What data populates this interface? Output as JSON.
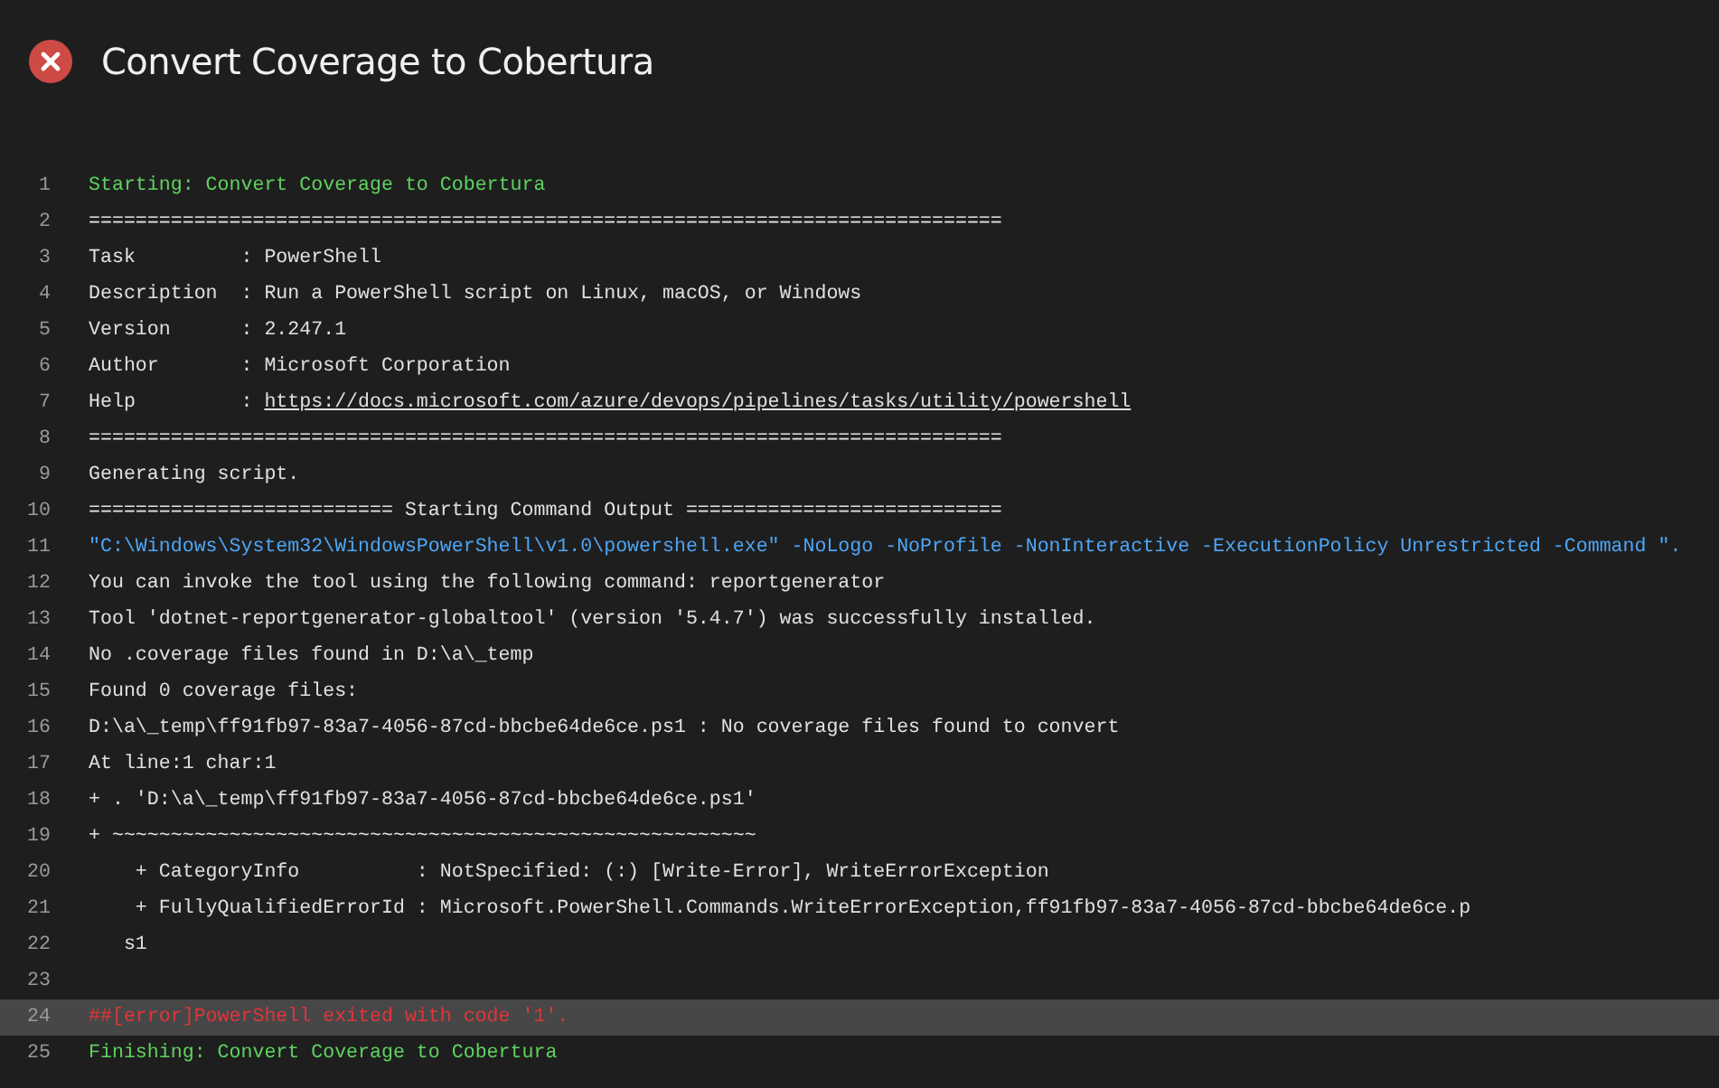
{
  "header": {
    "failed": true,
    "title": "Convert Coverage to Cobertura"
  },
  "log": [
    {
      "number": "1",
      "kind": "section",
      "text": "Starting: Convert Coverage to Cobertura"
    },
    {
      "number": "2",
      "kind": "plain",
      "text": "=============================================================================="
    },
    {
      "number": "3",
      "kind": "plain",
      "text": "Task         : PowerShell"
    },
    {
      "number": "4",
      "kind": "plain",
      "text": "Description  : Run a PowerShell script on Linux, macOS, or Windows"
    },
    {
      "number": "5",
      "kind": "plain",
      "text": "Version      : 2.247.1"
    },
    {
      "number": "6",
      "kind": "plain",
      "text": "Author       : Microsoft Corporation"
    },
    {
      "number": "7",
      "kind": "link",
      "text": "Help         : ",
      "link": "https://docs.microsoft.com/azure/devops/pipelines/tasks/utility/powershell"
    },
    {
      "number": "8",
      "kind": "plain",
      "text": "=============================================================================="
    },
    {
      "number": "9",
      "kind": "plain",
      "text": "Generating script."
    },
    {
      "number": "10",
      "kind": "plain",
      "text": "========================== Starting Command Output ==========================="
    },
    {
      "number": "11",
      "kind": "command",
      "text": "\"C:\\Windows\\System32\\WindowsPowerShell\\v1.0\\powershell.exe\" -NoLogo -NoProfile -NonInteractive -ExecutionPolicy Unrestricted -Command \"."
    },
    {
      "number": "12",
      "kind": "plain",
      "text": "You can invoke the tool using the following command: reportgenerator"
    },
    {
      "number": "13",
      "kind": "plain",
      "text": "Tool 'dotnet-reportgenerator-globaltool' (version '5.4.7') was successfully installed."
    },
    {
      "number": "14",
      "kind": "plain",
      "text": "No .coverage files found in D:\\a\\_temp"
    },
    {
      "number": "15",
      "kind": "plain",
      "text": "Found 0 coverage files:"
    },
    {
      "number": "16",
      "kind": "plain",
      "text": "D:\\a\\_temp\\ff91fb97-83a7-4056-87cd-bbcbe64de6ce.ps1 : No coverage files found to convert"
    },
    {
      "number": "17",
      "kind": "plain",
      "text": "At line:1 char:1"
    },
    {
      "number": "18",
      "kind": "plain",
      "text": "+ . 'D:\\a\\_temp\\ff91fb97-83a7-4056-87cd-bbcbe64de6ce.ps1'"
    },
    {
      "number": "19",
      "kind": "plain",
      "text": "+ ~~~~~~~~~~~~~~~~~~~~~~~~~~~~~~~~~~~~~~~~~~~~~~~~~~~~~~~"
    },
    {
      "number": "20",
      "kind": "plain",
      "text": "    + CategoryInfo          : NotSpecified: (:) [Write-Error], WriteErrorException"
    },
    {
      "number": "21",
      "kind": "plain",
      "text": "    + FullyQualifiedErrorId : Microsoft.PowerShell.Commands.WriteErrorException,ff91fb97-83a7-4056-87cd-bbcbe64de6ce.p"
    },
    {
      "number": "22",
      "kind": "plain",
      "text": "   s1"
    },
    {
      "number": "23",
      "kind": "plain"
    },
    {
      "number": "24",
      "kind": "error",
      "text": "##[error]PowerShell exited with code '1'."
    },
    {
      "number": "25",
      "kind": "section",
      "text": "Finishing: Convert Coverage to Cobertura"
    }
  ]
}
